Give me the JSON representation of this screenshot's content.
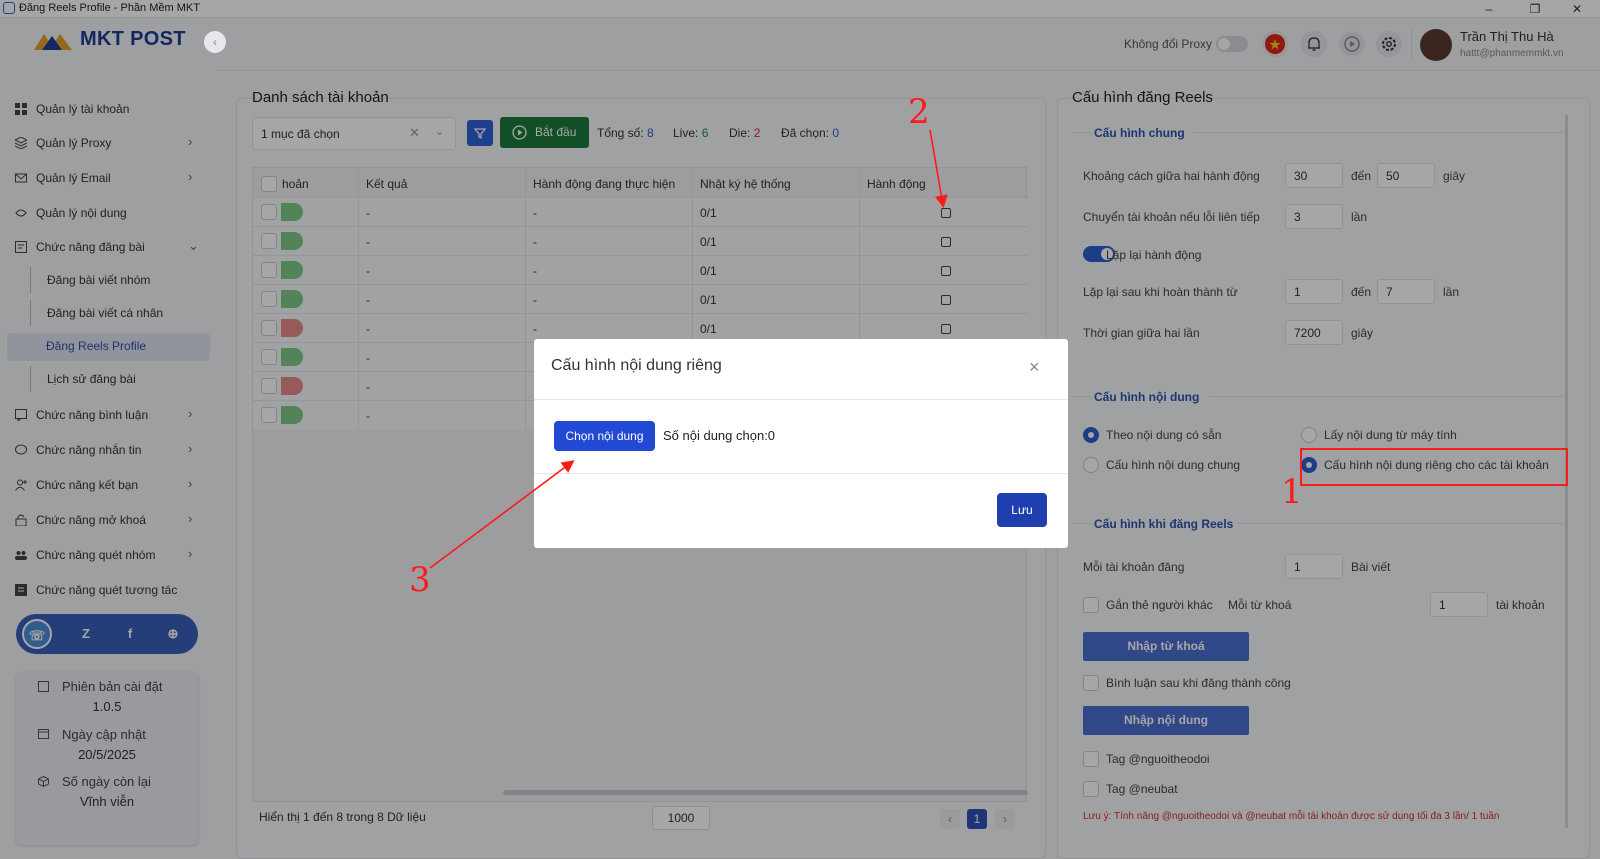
{
  "window": {
    "title": "Đăng Reels Profile - Phần Mềm MKT",
    "controls": [
      "–",
      "❐",
      "✕"
    ]
  },
  "brand": {
    "logo_text": "MKT POST"
  },
  "sidebar": {
    "items": [
      {
        "label": "Quản lý tài khoản",
        "icon": "accounts-grid-icon",
        "arrow": ""
      },
      {
        "label": "Quản lý Proxy",
        "icon": "proxy-icon",
        "arrow": "›"
      },
      {
        "label": "Quản lý Email",
        "icon": "email-icon",
        "arrow": "›"
      },
      {
        "label": "Quản lý nội dung",
        "icon": "content-icon",
        "arrow": ""
      },
      {
        "label": "Chức năng đăng bài",
        "icon": "post-icon",
        "arrow": "⌄"
      }
    ],
    "subitems": [
      {
        "label": "Đăng bài viết nhóm"
      },
      {
        "label": "Đăng bài viết cá nhân"
      },
      {
        "label": "Đăng Reels Profile"
      },
      {
        "label": "Lịch sử đăng bài"
      }
    ],
    "items2": [
      {
        "label": "Chức năng bình luận",
        "icon": "comment-icon",
        "arrow": "›"
      },
      {
        "label": "Chức năng nhắn tin",
        "icon": "message-icon",
        "arrow": "›"
      },
      {
        "label": "Chức năng kết bạn",
        "icon": "add-friend-icon",
        "arrow": "›"
      },
      {
        "label": "Chức năng mở khoá",
        "icon": "unlock-icon",
        "arrow": "›"
      },
      {
        "label": "Chức năng quét nhóm",
        "icon": "group-scan-icon",
        "arrow": "›"
      },
      {
        "label": "Chức năng quét tương tác",
        "icon": "interaction-scan-icon",
        "arrow": ""
      }
    ],
    "social": [
      {
        "icon": "support-headset-icon",
        "glyph": "☏"
      },
      {
        "icon": "zalo-icon",
        "glyph": "Z"
      },
      {
        "icon": "facebook-icon",
        "glyph": "f"
      },
      {
        "icon": "globe-icon",
        "glyph": "⊕"
      }
    ],
    "version_card": {
      "version_label": "Phiên bản cài đặt",
      "version": "1.0.5",
      "update_label": "Ngày cập nhật",
      "update_date": "20/5/2025",
      "days_label": "Số ngày còn lại",
      "days_value": "Vĩnh viễn"
    }
  },
  "header": {
    "proxy_label": "Không đổi Proxy",
    "user_name": "Trần Thị Thu Hà",
    "user_email": "hattt@phanmemmkt.vn"
  },
  "accounts": {
    "title": "Danh sách tài khoản",
    "select_value": "1 mục đã chọn",
    "start_label": "Bắt đầu",
    "stats": {
      "total_label": "Tổng số:",
      "total": "8",
      "live_label": "Live:",
      "live": "6",
      "die_label": "Die:",
      "die": "2",
      "selected_label": "Đã chọn:",
      "selected": "0"
    },
    "columns": [
      "hoản",
      "Kết quả",
      "Hành động đang thực hiện",
      "Nhật ký hệ thống",
      "Hành động"
    ],
    "rows": [
      {
        "status": "live",
        "result": "-",
        "doing": "-",
        "log": "0/1"
      },
      {
        "status": "live",
        "result": "-",
        "doing": "-",
        "log": "0/1"
      },
      {
        "status": "live",
        "result": "-",
        "doing": "-",
        "log": "0/1"
      },
      {
        "status": "live",
        "result": "-",
        "doing": "-",
        "log": "0/1"
      },
      {
        "status": "die",
        "result": "-",
        "doing": "-",
        "log": "0/1"
      },
      {
        "status": "live",
        "result": "-",
        "doing": "",
        "log": ""
      },
      {
        "status": "die",
        "result": "-",
        "doing": "",
        "log": ""
      },
      {
        "status": "live",
        "result": "-",
        "doing": "",
        "log": ""
      }
    ],
    "footer_text": "Hiển thị 1 đến 8 trong 8 Dữ liệu",
    "page_size": "1000",
    "page": "1",
    "prev": "‹",
    "next": "›"
  },
  "config": {
    "title": "Cấu hình đăng Reels",
    "general_title": "Cấu hình chung",
    "delay_label": "Khoảng cách giữa hai hành động",
    "delay_from": "30",
    "to_label": "đến",
    "delay_to": "50",
    "seconds_label": "giây",
    "switch_label": "Chuyển tài khoản nếu lỗi liên tiếp",
    "switch_value": "3",
    "times_label": "lần",
    "repeat_label": "Lặp lại hành động",
    "repeat_after_label": "Lặp lại sau khi hoàn thành từ",
    "repeat_from": "1",
    "repeat_to": "7",
    "interval_label": "Thời gian giữa hai lần",
    "interval_value": "7200",
    "content_title": "Cấu hình nội dung",
    "opt_available": "Theo nội dung có sẵn",
    "opt_from_pc": "Lấy nội dung từ máy tính",
    "opt_common": "Cấu hình nội dung chung",
    "opt_private": "Cấu hình nội dung riêng cho các tài khoản",
    "reels_title": "Cấu hình khi đăng Reels",
    "per_account_label": "Mỗi tài khoản đăng",
    "per_account_value": "1",
    "posts_label": "Bài viết",
    "tag_others_label": "Gắn thẻ người khác",
    "per_keyword_label": "Mỗi từ khoá",
    "per_keyword_value": "1",
    "accounts_label": "tài khoản",
    "keywords_btn": "Nhập từ khoá",
    "comment_label": "Bình luận sau khi đăng thành công",
    "content_btn": "Nhập nội dung",
    "tag1": "Tag @nguoitheodoi",
    "tag2": "Tag @neubat",
    "note": "Lưu ý: Tính năng @nguoitheodoi và @neubat mỗi tài khoản được sử dụng tối đa 3 lần/ 1 tuần"
  },
  "modal": {
    "title": "Cấu hình nội dung riêng",
    "close": "×",
    "choose_btn": "Chọn nội dung",
    "count_text": "Số nội dung chọn:0",
    "save_btn": "Lưu"
  },
  "annotations": {
    "n1": "1",
    "n2": "2",
    "n3": "3",
    "color": "#ff1a1a"
  },
  "colors": {
    "live": "#7fcb87",
    "die": "#e88a8a",
    "accent": "#2f5fcf",
    "start": "#1d7a3d"
  }
}
